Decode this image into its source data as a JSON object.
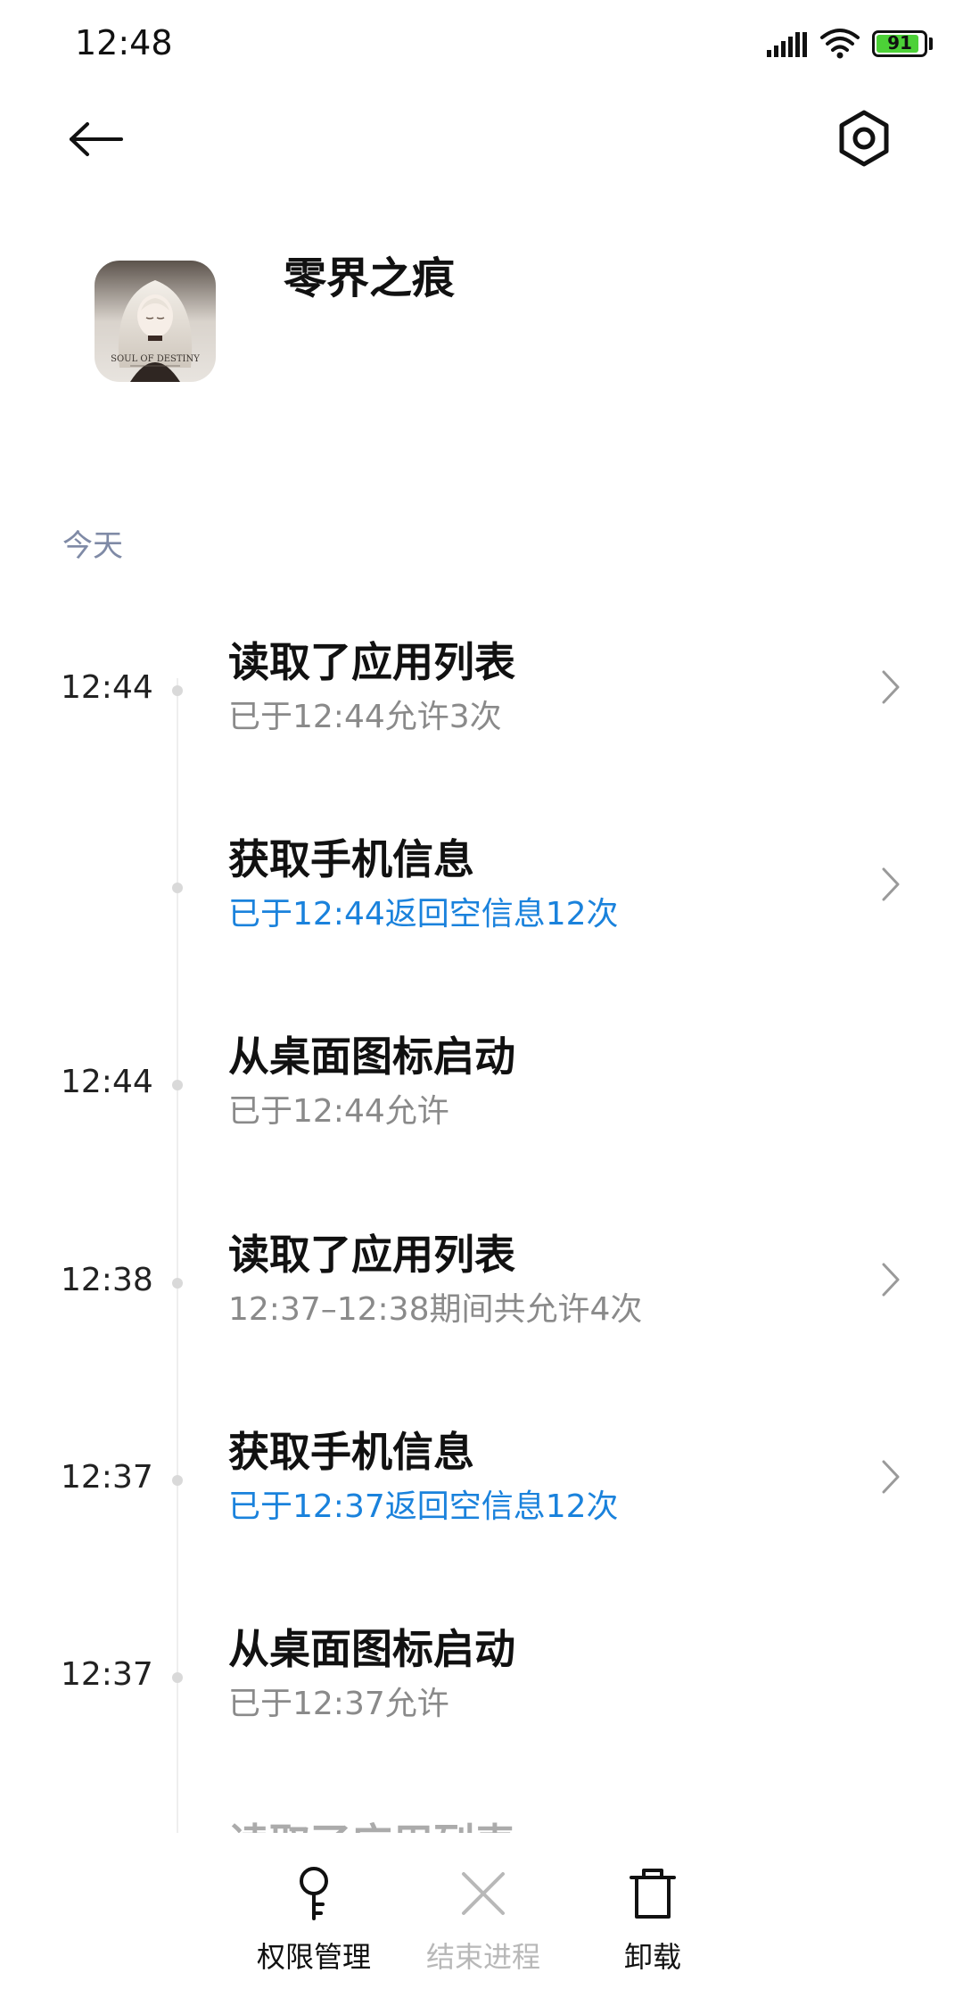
{
  "status_bar": {
    "time": "12:48",
    "battery_level": "91",
    "battery_fraction": 0.91,
    "battery_color": "#4cd137"
  },
  "app": {
    "name": "零界之痕",
    "icon_caption": "SOUL OF DESTINY"
  },
  "section": {
    "label": "今天"
  },
  "entries": [
    {
      "time": "12:44",
      "title": "读取了应用列表",
      "subtitle": "已于12:44允许3次",
      "subtitle_color": "gray",
      "has_chevron": true
    },
    {
      "time": "",
      "title": "获取手机信息",
      "subtitle": "已于12:44返回空信息12次",
      "subtitle_color": "blue",
      "has_chevron": true
    },
    {
      "time": "12:44",
      "title": "从桌面图标启动",
      "subtitle": "已于12:44允许",
      "subtitle_color": "gray",
      "has_chevron": false
    },
    {
      "time": "12:38",
      "title": "读取了应用列表",
      "subtitle": "12:37–12:38期间共允许4次",
      "subtitle_color": "gray",
      "has_chevron": true
    },
    {
      "time": "12:37",
      "title": "获取手机信息",
      "subtitle": "已于12:37返回空信息12次",
      "subtitle_color": "blue",
      "has_chevron": true
    },
    {
      "time": "12:37",
      "title": "从桌面图标启动",
      "subtitle": "已于12:37允许",
      "subtitle_color": "gray",
      "has_chevron": false
    }
  ],
  "partial_entry": {
    "title": "读取了应用列表"
  },
  "bottom_bar": {
    "permissions_label": "权限管理",
    "end_process_label": "结束进程",
    "uninstall_label": "卸载"
  },
  "icons": {
    "back": "arrow-left-icon",
    "settings": "gear-hexagon-icon",
    "permissions": "key-icon",
    "end_process": "close-x-icon",
    "uninstall": "trash-icon",
    "chevron": "chevron-right-icon"
  },
  "colors": {
    "accent_blue": "#1a82dc",
    "section_label": "#7f8aa6",
    "subtitle_gray": "#8a8a8a"
  }
}
